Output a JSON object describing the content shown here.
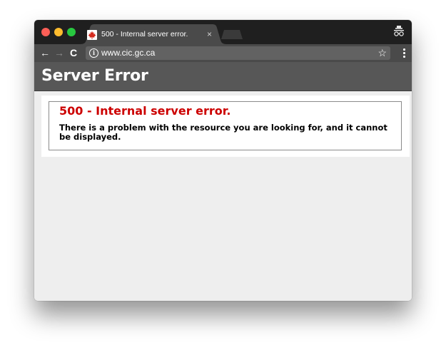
{
  "window": {
    "colors": {
      "titlebar": "#1f1f1f",
      "toolbar": "#4a4a4a",
      "header": "#575757",
      "error_heading": "#cc0000",
      "traffic_close": "#fc5f57",
      "traffic_minimize": "#fdbc2e",
      "traffic_maximize": "#28c840"
    }
  },
  "tab": {
    "title": "500 - Internal server error.",
    "favicon": "maple-leaf-icon",
    "close_label": "×"
  },
  "toolbar": {
    "back_label": "←",
    "forward_label": "→",
    "reload_label": "C",
    "url": "www.cic.gc.ca",
    "info_label": "i",
    "star_label": "☆"
  },
  "page": {
    "header_title": "Server Error",
    "error_heading": "500 - Internal server error.",
    "error_message": "There is a problem with the resource you are looking for, and it cannot be displayed."
  }
}
